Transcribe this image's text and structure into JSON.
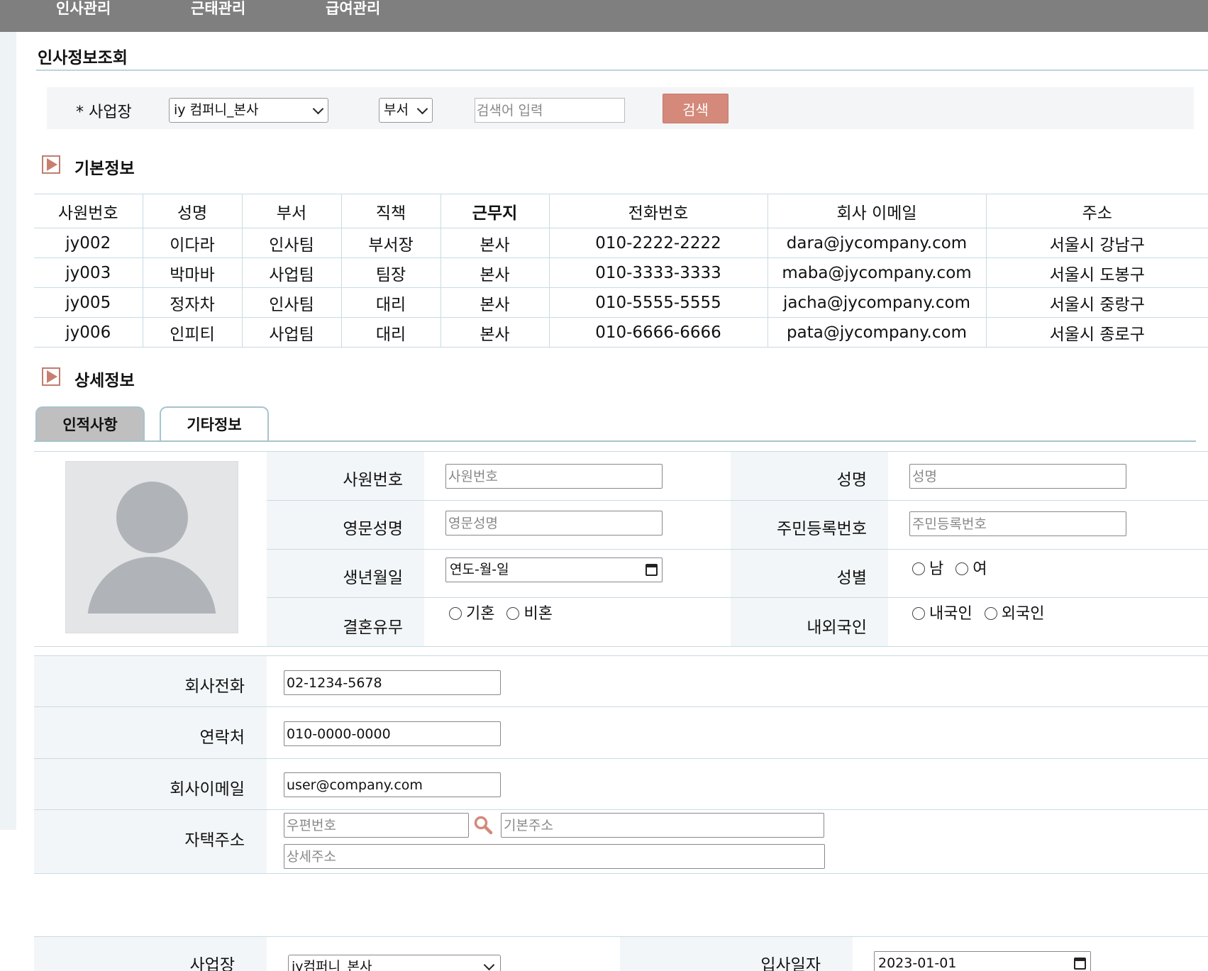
{
  "nav": {
    "items": [
      "인사관리",
      "근태관리",
      "급여관리"
    ]
  },
  "page": {
    "title": "인사정보조회"
  },
  "search": {
    "site_label": "* 사업장",
    "site_value": "iy 컴퍼니_본사",
    "dept_value": "부서",
    "query_placeholder": "검색어 입력",
    "button_label": "검색"
  },
  "basic": {
    "title": "기본정보",
    "columns": [
      "사원번호",
      "성명",
      "부서",
      "직책",
      "근무지",
      "전화번호",
      "회사 이메일",
      "주소"
    ],
    "rows": [
      [
        "jy002",
        "이다라",
        "인사팀",
        "부서장",
        "본사",
        "010-2222-2222",
        "dara@jycompany.com",
        "서울시 강남구"
      ],
      [
        "jy003",
        "박마바",
        "사업팀",
        "팀장",
        "본사",
        "010-3333-3333",
        "maba@jycompany.com",
        "서울시 도봉구"
      ],
      [
        "jy005",
        "정자차",
        "인사팀",
        "대리",
        "본사",
        "010-5555-5555",
        "jacha@jycompany.com",
        "서울시 중랑구"
      ],
      [
        "jy006",
        "인피티",
        "사업팀",
        "대리",
        "본사",
        "010-6666-6666",
        "pata@jycompany.com",
        "서울시 종로구"
      ]
    ]
  },
  "detail": {
    "title": "상세정보",
    "tabs": [
      "인적사항",
      "기타정보"
    ],
    "fields": {
      "emp_no": {
        "label": "사원번호",
        "placeholder": "사원번호"
      },
      "name": {
        "label": "성명",
        "placeholder": "성명"
      },
      "eng_name": {
        "label": "영문성명",
        "placeholder": "영문성명"
      },
      "rrn": {
        "label": "주민등록번호",
        "placeholder": "주민등록번호"
      },
      "birth": {
        "label": "생년월일",
        "value": "연도-월-일"
      },
      "gender": {
        "label": "성별",
        "options": [
          "남",
          "여"
        ]
      },
      "marriage": {
        "label": "결혼유무",
        "options": [
          "기혼",
          "비혼"
        ]
      },
      "nationality": {
        "label": "내외국인",
        "options": [
          "내국인",
          "외국인"
        ]
      },
      "company_phone": {
        "label": "회사전화",
        "value": "02-1234-5678"
      },
      "contact": {
        "label": "연락처",
        "value": "010-0000-0000"
      },
      "company_email": {
        "label": "회사이메일",
        "value": "user@company.com"
      },
      "home_address": {
        "label": "자택주소",
        "zip_placeholder": "우편번호",
        "base_placeholder": "기본주소",
        "detail_placeholder": "상세주소"
      },
      "site": {
        "label": "사업장",
        "value": "jy컴퍼니_본사"
      },
      "join_date": {
        "label": "입사일자",
        "value": "2023-01-01"
      }
    }
  },
  "colors": {
    "nav_bg": "#7f7f7f",
    "accent": "#d4897a",
    "border": "#c8dbe2",
    "label_bg": "#f3f6f8"
  },
  "icons": {
    "section": "play-icon",
    "search": "search-icon",
    "calendar": "calendar-icon",
    "photo": "avatar-placeholder-icon"
  }
}
